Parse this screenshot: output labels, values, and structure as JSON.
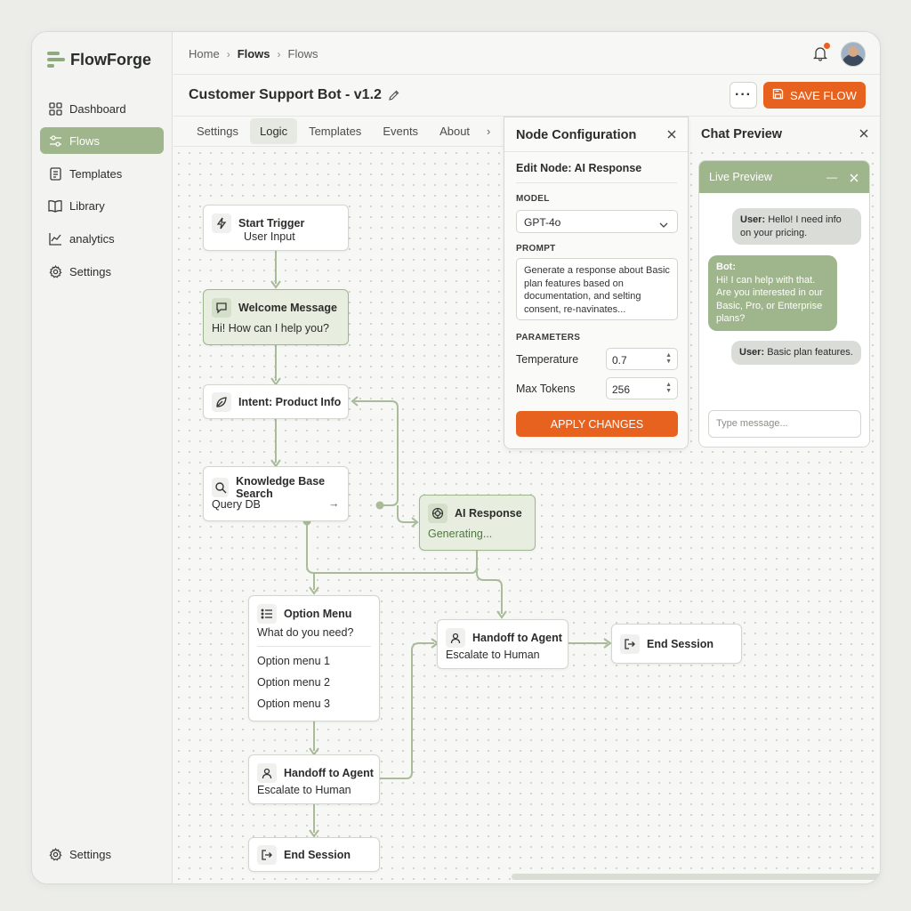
{
  "app": {
    "name": "FlowForge"
  },
  "sidebar": {
    "items": [
      {
        "label": "Dashboard",
        "icon": "grid-icon"
      },
      {
        "label": "Flows",
        "icon": "sliders-icon",
        "active": true
      },
      {
        "label": "Templates",
        "icon": "document-icon"
      },
      {
        "label": "Library",
        "icon": "book-icon"
      },
      {
        "label": "analytics",
        "icon": "chart-icon"
      },
      {
        "label": "Settings",
        "icon": "gear-icon"
      }
    ],
    "footer": {
      "label": "Settings",
      "icon": "gear-icon"
    }
  },
  "breadcrumb": [
    "Home",
    "Flows",
    "Flows"
  ],
  "header": {
    "title": "Customer Support Bot - v1.2",
    "save_label": "SAVE FLOW",
    "more_label": "···"
  },
  "tabs": {
    "items": [
      "Settings",
      "Logic",
      "Templates",
      "Events",
      "About"
    ],
    "active": "Logic"
  },
  "nodes": {
    "start": {
      "title": "Start Trigger",
      "sub": "User Input"
    },
    "welcome": {
      "title": "Welcome Message",
      "sub": "Hi! How can I help you?"
    },
    "intent": {
      "title": "Intent: Product Info"
    },
    "kb": {
      "title": "Knowledge Base Search",
      "sub": "Query DB",
      "arrow": "→"
    },
    "ai": {
      "title": "AI Response",
      "sub": "Generating..."
    },
    "option": {
      "title": "Option Menu",
      "sub": "What do you need?",
      "options": [
        "Option menu 1",
        "Option menu 2",
        "Option menu 3"
      ]
    },
    "handoff_right": {
      "title": "Handoff to Agent",
      "sub": "Escalate to Human"
    },
    "end_right": {
      "title": "End Session"
    },
    "handoff_left": {
      "title": "Handoff to Agent",
      "sub": "Escalate to Human"
    },
    "end_left": {
      "title": "End Session"
    }
  },
  "config": {
    "title": "Node Configuration",
    "subtitle": "Edit Node: AI Response",
    "model_label": "MODEL",
    "model_value": "GPT-4o",
    "prompt_label": "PROMPT",
    "prompt_value": "Generate a response about Basic plan features based on documentation, and selting consent, re-navinates...",
    "parameters_label": "PARAMETERS",
    "temperature_label": "Temperature",
    "temperature_value": "0.7",
    "max_tokens_label": "Max Tokens",
    "max_tokens_value": "256",
    "apply_label": "APPLY CHANGES"
  },
  "chat": {
    "title": "Chat Preview",
    "live_title": "Live Preview",
    "messages": [
      {
        "role": "User:",
        "text": "Hello! I need info on your pricing."
      },
      {
        "role": "Bot:",
        "text": "Hi! I can help with that. Are you interested in our Basic, Pro, or Enterprise plans?"
      },
      {
        "role": "User:",
        "text": "Basic plan features."
      }
    ],
    "input_placeholder": "Type message..."
  },
  "colors": {
    "accent": "#e8621f",
    "brand_green": "#9fb58c",
    "wire": "#a9bb99",
    "notification": "#e8621f"
  }
}
